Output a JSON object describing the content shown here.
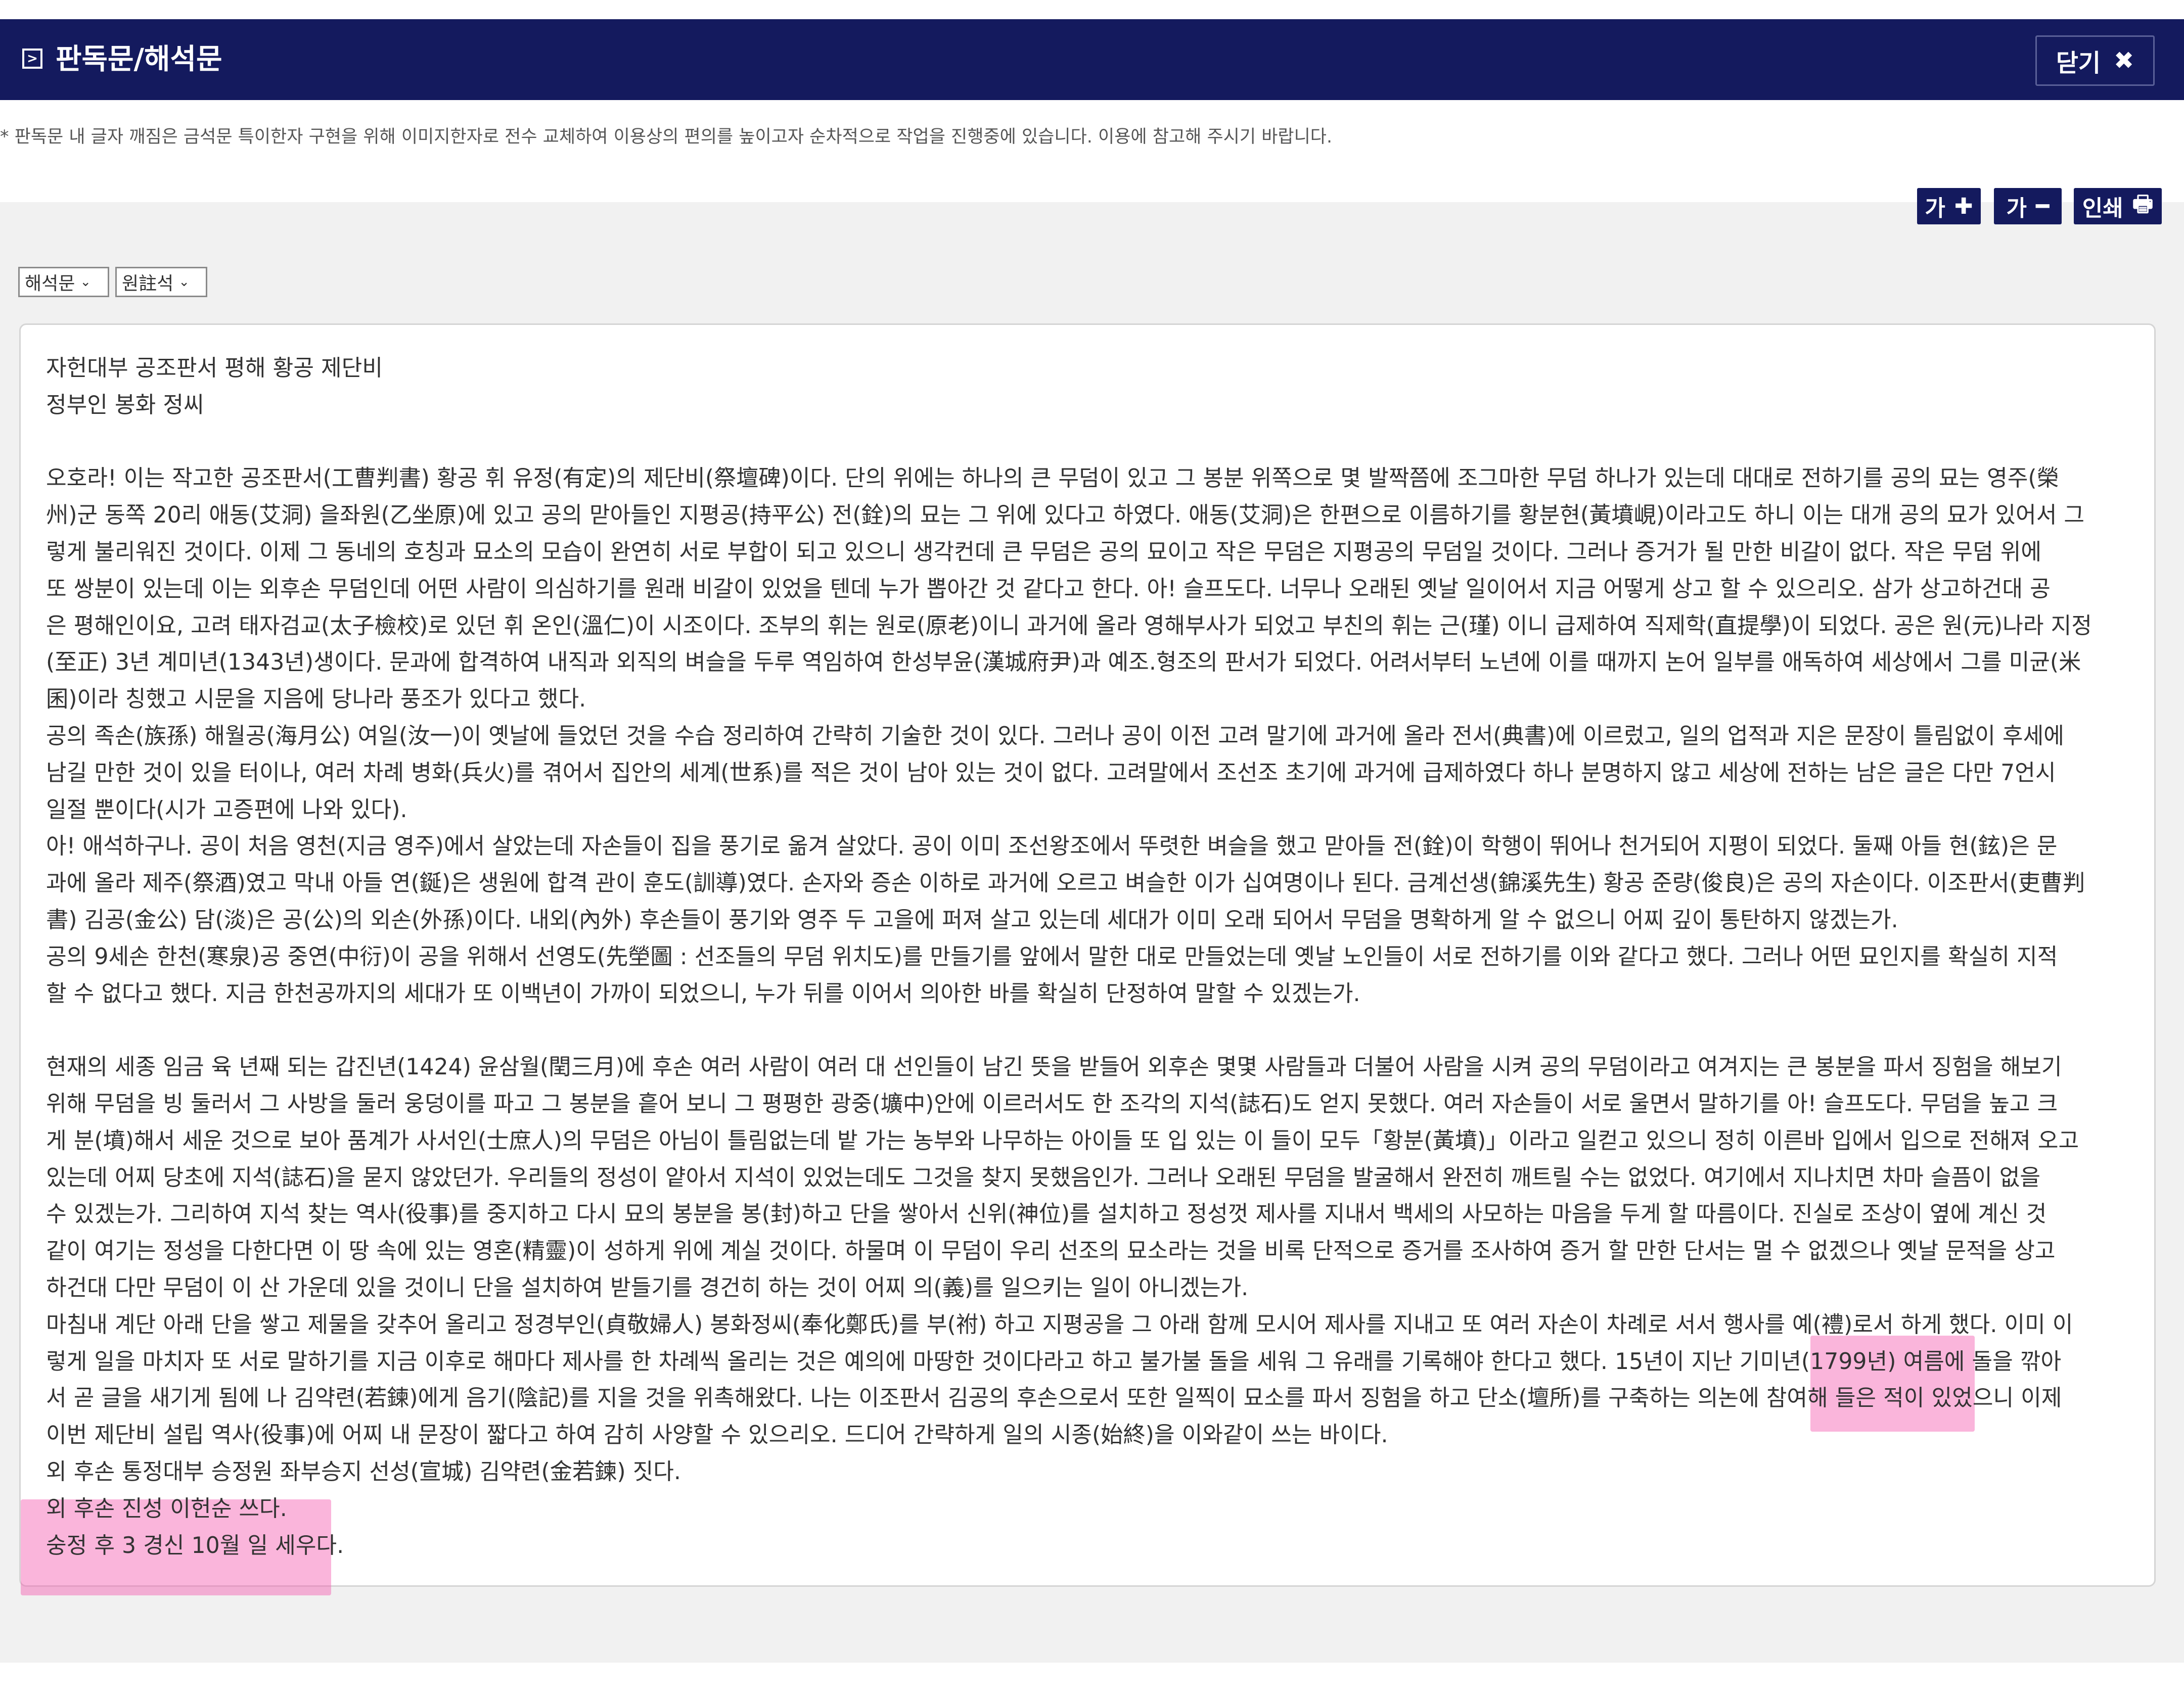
{
  "header": {
    "title": "판독문/해석문",
    "close_label": "닫기",
    "close_icon": "✖"
  },
  "notice": "* 판독문 내 글자 깨짐은 금석문 특이한자 구현을 위해 이미지한자로 전수 교체하여 이용상의 편의를 높이고자 순차적으로 작업을 진행중에 있습니다. 이용에 참고해 주시기 바랍니다.",
  "toolbar": {
    "font_up_label": "가",
    "font_up_icon": "✚",
    "font_down_label": "가",
    "font_down_icon": "━",
    "print_label": "인쇄",
    "print_icon": "🖶"
  },
  "selects": {
    "type_value": "해석문",
    "type_chevron": "⌄",
    "notes_value": "원註석",
    "notes_chevron": "⌄"
  },
  "content": {
    "lines": [
      "자헌대부 공조판서 평해 황공 제단비",
      "정부인 봉화 정씨",
      "",
      "오호라! 이는 작고한 공조판서(工曹判書) 황공 휘 유정(有定)의 제단비(祭壇碑)이다. 단의 위에는 하나의 큰 무덤이 있고 그 봉분 위쪽으로 몇 발짝쯤에 조그마한 무덤 하나가 있는데 대대로 전하기를 공의 묘는 영주(榮",
      "州)군 동쪽 20리 애동(艾洞) 을좌원(乙坐原)에 있고 공의 맏아들인 지평공(持平公) 전(銓)의 묘는 그 위에 있다고 하였다. 애동(艾洞)은 한편으로 이름하기를 황분현(黃墳峴)이라고도 하니 이는 대개 공의 묘가 있어서 그",
      "렇게 불리워진 것이다. 이제 그 동네의 호칭과 묘소의 모습이 완연히 서로 부합이 되고 있으니 생각컨데 큰 무덤은 공의 묘이고 작은 무덤은 지평공의 무덤일 것이다. 그러나 증거가 될 만한 비갈이 없다. 작은 무덤 위에",
      "또 쌍분이 있는데 이는 외후손 무덤인데 어떤 사람이 의심하기를 원래 비갈이 있었을 텐데 누가 뽑아간 것 같다고 한다. 아! 슬프도다. 너무나 오래된 옛날 일이어서 지금 어떻게 상고 할 수 있으리오. 삼가 상고하건대 공",
      "은 평해인이요, 고려 태자검교(太子檢校)로 있던 휘 온인(溫仁)이 시조이다. 조부의 휘는 원로(原老)이니 과거에 올라 영해부사가 되었고 부친의 휘는 근(瑾) 이니 급제하여 직제학(直提學)이 되었다. 공은 원(元)나라 지정",
      "(至正) 3년 계미년(1343년)생이다. 문과에 합격하여 내직과 외직의 벼슬을 두루 역임하여 한성부윤(漢城府尹)과 예조.형조의 판서가 되었다. 어려서부터 노년에 이를 때까지 논어 일부를 애독하여 세상에서 그를 미균(米",
      "囷)이라 칭했고 시문을 지음에 당나라 풍조가 있다고 했다.",
      "공의 족손(族孫) 해월공(海月公) 여일(汝一)이 옛날에 들었던 것을 수습 정리하여 간략히 기술한 것이 있다. 그러나 공이 이전 고려 말기에 과거에 올라 전서(典書)에 이르렀고, 일의 업적과 지은 문장이 틀림없이 후세에",
      "남길 만한 것이 있을 터이나, 여러 차례 병화(兵火)를 겪어서 집안의 세계(世系)를 적은 것이 남아 있는 것이 없다. 고려말에서 조선조 초기에 과거에 급제하였다 하나 분명하지 않고 세상에 전하는 남은 글은 다만 7언시",
      "일절 뿐이다(시가 고증편에 나와 있다).",
      "아! 애석하구나. 공이 처음 영천(지금 영주)에서 살았는데 자손들이 집을 풍기로 옮겨 살았다. 공이 이미 조선왕조에서 뚜렷한 벼슬을 했고 맏아들 전(銓)이 학행이 뛰어나 천거되어 지평이 되었다. 둘째 아들 현(鉉)은 문",
      "과에 올라 제주(祭酒)였고 막내 아들 연(鋋)은 생원에 합격 관이 훈도(訓導)였다. 손자와 증손 이하로 과거에 오르고 벼슬한 이가 십여명이나 된다. 금계선생(錦溪先生) 황공 준량(俊良)은 공의 자손이다. 이조판서(吏曹判",
      "書) 김공(金公) 담(淡)은 공(公)의 외손(外孫)이다. 내외(內外) 후손들이 풍기와 영주 두 고을에 퍼져 살고 있는데 세대가 이미 오래 되어서 무덤을 명확하게 알 수 없으니 어찌 깊이 통탄하지 않겠는가.",
      "공의 9세손 한천(寒泉)공 중연(中衍)이 공을 위해서 선영도(先塋圖 : 선조들의 무덤 위치도)를 만들기를 앞에서 말한 대로 만들었는데 옛날 노인들이 서로 전하기를 이와 같다고 했다. 그러나 어떤 묘인지를 확실히 지적",
      "할 수 없다고 했다. 지금 한천공까지의 세대가 또 이백년이 가까이 되었으니, 누가 뒤를 이어서 의아한 바를 확실히 단정하여 말할 수 있겠는가.",
      "",
      "현재의 세종 임금 육 년째 되는 갑진년(1424) 윤삼월(閏三月)에 후손 여러 사람이 여러 대 선인들이 남긴 뜻을 받들어 외후손 몇몇 사람들과 더불어 사람을 시켜 공의 무덤이라고 여겨지는 큰 봉분을 파서 징험을 해보기",
      "위해 무덤을 빙 둘러서 그 사방을 둘러 웅덩이를 파고 그 봉분을 흩어 보니 그 평평한 광중(壙中)안에 이르러서도 한 조각의 지석(誌石)도 얻지 못했다. 여러 자손들이 서로 울면서 말하기를 아! 슬프도다. 무덤을 높고 크",
      "게 분(墳)해서 세운 것으로 보아 품계가 사서인(士庶人)의 무덤은 아님이 틀림없는데 밭 가는 농부와 나무하는 아이들 또 입 있는 이 들이 모두「황분(黃墳)」이라고 일컫고 있으니 정히 이른바 입에서 입으로 전해져 오고",
      "있는데 어찌 당초에 지석(誌石)을 묻지 않았던가. 우리들의 정성이 얕아서 지석이 있었는데도 그것을 찾지 못했음인가. 그러나 오래된 무덤을 발굴해서 완전히 깨트릴 수는 없었다. 여기에서 지나치면 차마 슬픔이 없을",
      "수 있겠는가. 그리하여 지석 찾는 역사(役事)를 중지하고 다시 묘의 봉분을 봉(封)하고 단을 쌓아서 신위(神位)를 설치하고 정성껏 제사를 지내서 백세의 사모하는 마음을 두게 할 따름이다. 진실로 조상이 옆에 계신 것",
      "같이 여기는 정성을 다한다면 이 땅 속에 있는 영혼(精靈)이 성하게 위에 계실 것이다. 하물며 이 무덤이 우리 선조의 묘소라는 것을 비록 단적으로 증거를 조사하여 증거 할 만한 단서는 멀 수 없겠으나 옛날 문적을 상고",
      "하건대 다만 무덤이 이 산 가운데 있을 것이니 단을 설치하여 받들기를 경건히 하는 것이 어찌 의(義)를 일으키는 일이 아니겠는가.",
      "마침내 계단 아래 단을 쌓고 제물을 갖추어 올리고 정경부인(貞敬婦人) 봉화정씨(奉化鄭氏)를 부(祔) 하고 지평공을 그 아래 함께 모시어 제사를 지내고 또 여러 자손이 차례로 서서 행사를 예(禮)로서 하게 했다. 이미 이",
      "렇게 일을 마치자 또 서로 말하기를 지금 이후로 해마다 제사를 한 차례씩 올리는 것은 예의에 마땅한 것이다라고 하고 불가불 돌을 세워 그 유래를 기록해야 한다고 했다. 15년이 지난 기미년(1799년) 여름에 돌을 깎아",
      "서 곧 글을 새기게 됨에 나 김약련(若鍊)에게 음기(陰記)를 지을 것을 위촉해왔다. 나는 이조판서 김공의 후손으로서 또한 일찍이 묘소를 파서 징험을 하고 단소(壇所)를 구축하는 의논에 참여해 들은 적이 있었으니 이제",
      "이번 제단비 설립 역사(役事)에 어찌 내 문장이 짧다고 하여 감히 사양할 수 있으리오. 드디어 간략하게 일의 시종(始終)을 이와같이 쓰는 바이다.",
      "외 후손 통정대부 승정원 좌부승지 선성(宣城) 김약련(金若鍊) 짓다.",
      "외 후손 진성 이헌순 쓰다.",
      "숭정 후 3 경신 10월 일 세우다."
    ]
  }
}
